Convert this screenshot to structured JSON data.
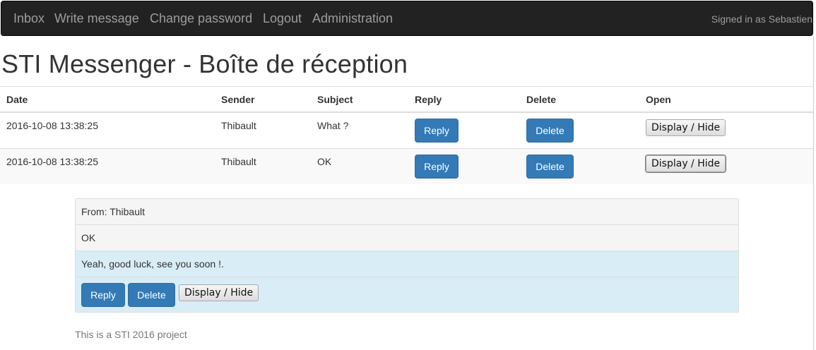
{
  "navbar": {
    "links": [
      "Inbox",
      "Write message",
      "Change password",
      "Logout",
      "Administration"
    ],
    "signed_in": "Signed in as Sebastien"
  },
  "page": {
    "title": "STI Messenger - Boîte de réception"
  },
  "table": {
    "headers": [
      "Date",
      "Sender",
      "Subject",
      "Reply",
      "Delete",
      "Open"
    ],
    "rows": [
      {
        "date": "2016-10-08 13:38:25",
        "sender": "Thibault",
        "subject": "What ?",
        "reply": "Reply",
        "delete": "Delete",
        "open": "Display / Hide"
      },
      {
        "date": "2016-10-08 13:38:25",
        "sender": "Thibault",
        "subject": "OK",
        "reply": "Reply",
        "delete": "Delete",
        "open": "Display / Hide"
      }
    ]
  },
  "message": {
    "from": "From: Thibault",
    "subject": "OK",
    "body": "Yeah, good luck, see you soon !.",
    "reply": "Reply",
    "delete": "Delete",
    "toggle": "Display / Hide"
  },
  "footer": {
    "text": "This is a STI 2016 project"
  },
  "colors": {
    "navbar_bg": "#222222",
    "nav_text": "#9d9d9d",
    "primary": "#337ab7",
    "info_bg": "#d9edf7",
    "striped_bg": "#f9f9f9"
  }
}
